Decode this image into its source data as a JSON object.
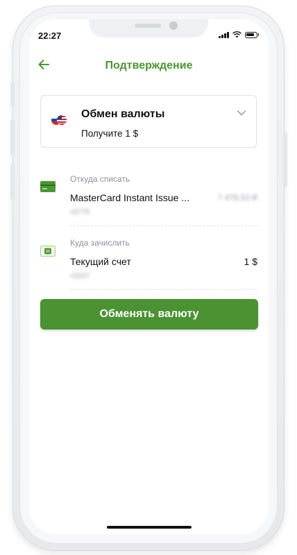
{
  "status_bar": {
    "time": "22:27"
  },
  "header": {
    "title": "Подтверждение",
    "back_icon": "arrow-left-icon"
  },
  "exchange_card": {
    "title": "Обмен валюты",
    "subtitle": "Получите 1 $",
    "flag_icon": "us-ru-flags-icon",
    "chevron_icon": "chevron-down-icon"
  },
  "from": {
    "label": "Откуда списать",
    "account_name": "MasterCard Instant Issue ...",
    "balance": "7 478.53 ₽",
    "account_number": "•3775",
    "icon": "credit-card-icon"
  },
  "to": {
    "label": "Куда зачислить",
    "account_name": "Текущий счет",
    "amount": "1 $",
    "account_number": "•3337",
    "icon": "wallet-icon"
  },
  "action": {
    "button_label": "Обменять валюту"
  },
  "colors": {
    "accent": "#4a9632",
    "button": "#4a9232"
  }
}
